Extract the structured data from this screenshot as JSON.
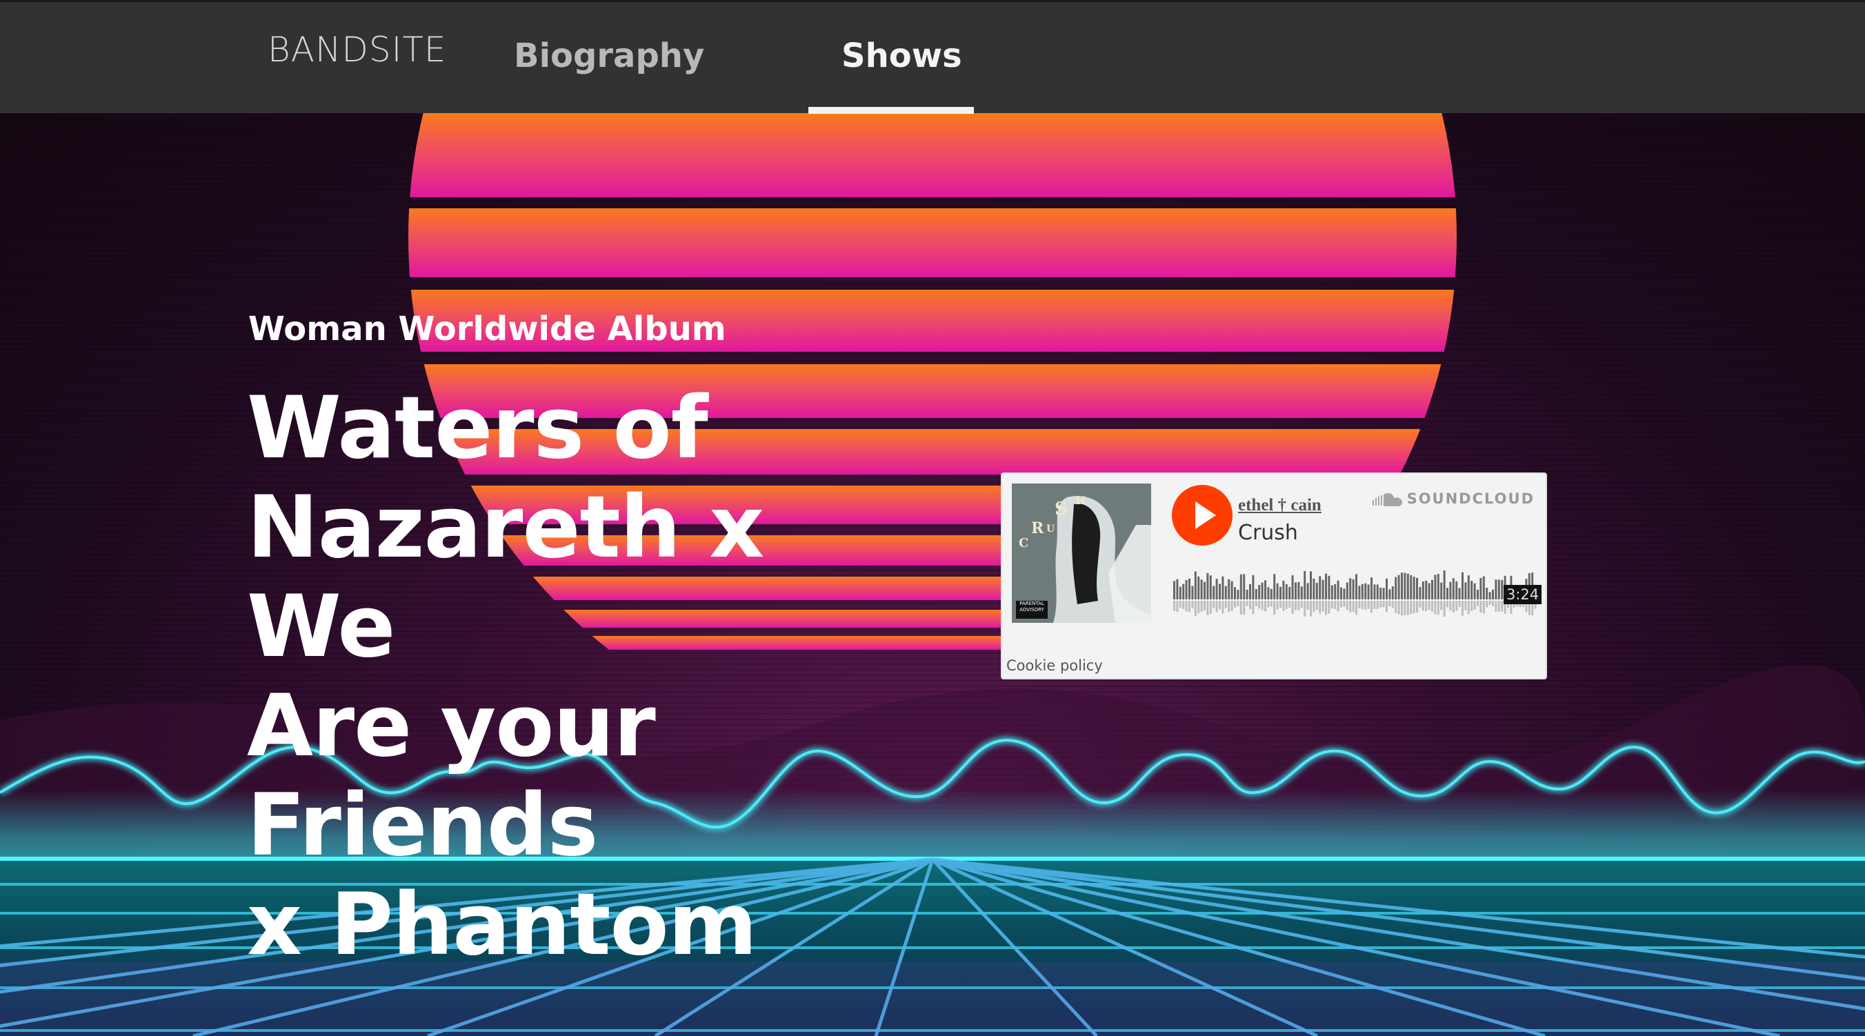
{
  "nav": {
    "logo": "BANDSITE",
    "links": [
      {
        "label": "Biography"
      },
      {
        "label": "Shows",
        "active": true
      }
    ]
  },
  "hero": {
    "eyebrow": "Woman Worldwide Album",
    "headline_lines": [
      "Waters of",
      "Nazareth x We",
      "Are your Friends",
      "x Phantom"
    ]
  },
  "soundcloud": {
    "brand": "SOUNDCLOUD",
    "artist": "ethel † cain",
    "track": "Crush",
    "duration": "3:24",
    "cookie_policy": "Cookie policy",
    "play_color": "#ff3d00",
    "artwork_letters": "CRUSH"
  },
  "colors": {
    "nav_bg": "#323232",
    "accent_cyan": "#29e3ec",
    "sun_top": "#fa7a1c",
    "sun_bottom": "#e21c9e"
  }
}
